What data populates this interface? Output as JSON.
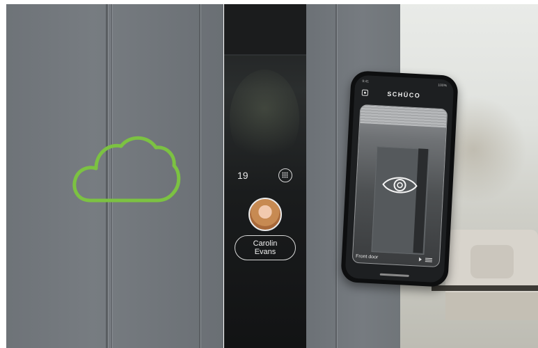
{
  "intercom": {
    "house_number": "19",
    "contact_name_line1": "Carolin",
    "contact_name_line2": "Evans",
    "keypad_icon": "keypad-grid-icon",
    "avatar_icon": "contact-avatar"
  },
  "phone_app": {
    "brand": "SCHÜCO",
    "status_left": "9:41",
    "status_right": "100%",
    "camera_location": "Front door",
    "view_icon": "eye-icon",
    "settings_icon": "settings-icon"
  },
  "decor": {
    "cloud_icon": "cloud-icon",
    "accent_color": "#7cc242"
  }
}
